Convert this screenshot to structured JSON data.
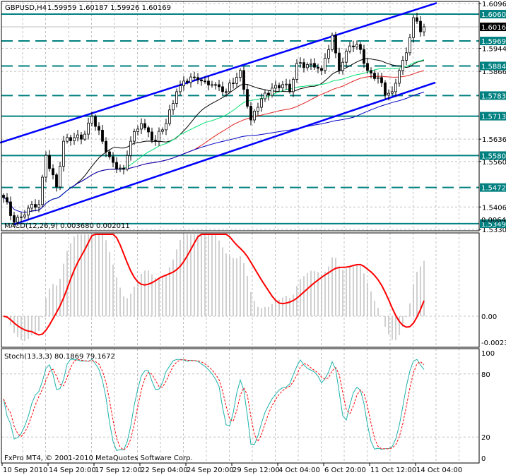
{
  "header": {
    "symbol": "GBPUSD,H4",
    "ohlc": "1.59959 1.60187 1.59926 1.60169"
  },
  "footer": {
    "copyright": "FxPro MT4, © 2001-2010 MetaQuotes Software Corp."
  },
  "colors": {
    "level": "#008080",
    "channel": "#0000ff",
    "current": "#000000",
    "macd_signal": "#ff0000",
    "macd_hist": "#c0c0c0",
    "stoch_main": "#20b2aa",
    "stoch_signal": "#ff0000",
    "ma_fast": "#000000",
    "ma_mid": "#00e070",
    "ma_slow": "#e02020",
    "ma_long": "#0000c0"
  },
  "chart_data": {
    "type": "candlestick",
    "symbol": "GBPUSD",
    "timeframe": "H4",
    "price_axis": {
      "ticks": [
        "1.60960",
        "1.59440",
        "1.58660",
        "1.56360",
        "1.55600",
        "1.54060",
        "1.53300"
      ],
      "range": [
        1.533,
        1.6096
      ]
    },
    "date_axis": {
      "ticks": [
        "10 Sep 2010",
        "14 Sep 20:00",
        "17 Sep 12:00",
        "22 Sep 04:00",
        "24 Sep 20:00",
        "29 Sep 12:00",
        "4 Oct 04:00",
        "6 Oct 20:00",
        "11 Oct 12:00",
        "14 Oct 04:00"
      ],
      "bars_per_tick": 13
    },
    "bar_count": 120,
    "close_keyframes": [
      [
        0,
        1.5438
      ],
      [
        3,
        1.5354
      ],
      [
        7,
        1.5402
      ],
      [
        10,
        1.5414
      ],
      [
        12,
        1.5581
      ],
      [
        15,
        1.5474
      ],
      [
        17,
        1.5629
      ],
      [
        20,
        1.5641
      ],
      [
        23,
        1.5653
      ],
      [
        25,
        1.5713
      ],
      [
        29,
        1.5593
      ],
      [
        31,
        1.5557
      ],
      [
        34,
        1.5534
      ],
      [
        36,
        1.5629
      ],
      [
        39,
        1.5689
      ],
      [
        43,
        1.5629
      ],
      [
        46,
        1.5689
      ],
      [
        49,
        1.5797
      ],
      [
        51,
        1.5833
      ],
      [
        54,
        1.5845
      ],
      [
        57,
        1.5833
      ],
      [
        59,
        1.5821
      ],
      [
        63,
        1.5797
      ],
      [
        67,
        1.5869
      ],
      [
        70,
        1.5701
      ],
      [
        73,
        1.5773
      ],
      [
        76,
        1.5809
      ],
      [
        79,
        1.5821
      ],
      [
        81,
        1.5797
      ],
      [
        83,
        1.5893
      ],
      [
        87,
        1.5893
      ],
      [
        90,
        1.5869
      ],
      [
        93,
        1.5988
      ],
      [
        95,
        1.5869
      ],
      [
        98,
        1.5952
      ],
      [
        101,
        1.594
      ],
      [
        103,
        1.5869
      ],
      [
        106,
        1.5845
      ],
      [
        108,
        1.5785
      ],
      [
        110,
        1.5797
      ],
      [
        112,
        1.5869
      ],
      [
        114,
        1.5929
      ],
      [
        116,
        1.6048
      ],
      [
        118,
        1.6
      ],
      [
        119,
        1.60169
      ]
    ],
    "levels": [
      {
        "price": "1.60600",
        "style": "solid"
      },
      {
        "price": "1.59691",
        "style": "dashed"
      },
      {
        "price": "1.58843",
        "style": "dashed"
      },
      {
        "price": "1.57838",
        "style": "dashed"
      },
      {
        "price": "1.57139",
        "style": "solid"
      },
      {
        "price": "1.55803",
        "style": "solid"
      },
      {
        "price": "1.54720",
        "style": "dashed"
      },
      {
        "price": "1.53493",
        "style": "solid"
      }
    ],
    "current_price": "1.60169",
    "channel": {
      "upper": [
        [
          -1,
          1.5624
        ],
        [
          122.6,
          1.6098
        ]
      ],
      "lower": [
        [
          3,
          1.5347
        ],
        [
          122.2,
          1.5828
        ]
      ]
    },
    "moving_averages": [
      21,
      34,
      55,
      100
    ],
    "macd": {
      "label": "MACD(12,26,9) 0.003680 0.002011",
      "ticks": [
        "0.00645",
        "0.00",
        "-0.00231"
      ],
      "range": [
        -0.00231,
        0.00645
      ]
    },
    "stochastic": {
      "label": "Stoch(13,3,3) 80.1869 79.1672",
      "ticks": [
        "100",
        "80",
        "20",
        "0"
      ],
      "levels": [
        20,
        80
      ]
    }
  }
}
